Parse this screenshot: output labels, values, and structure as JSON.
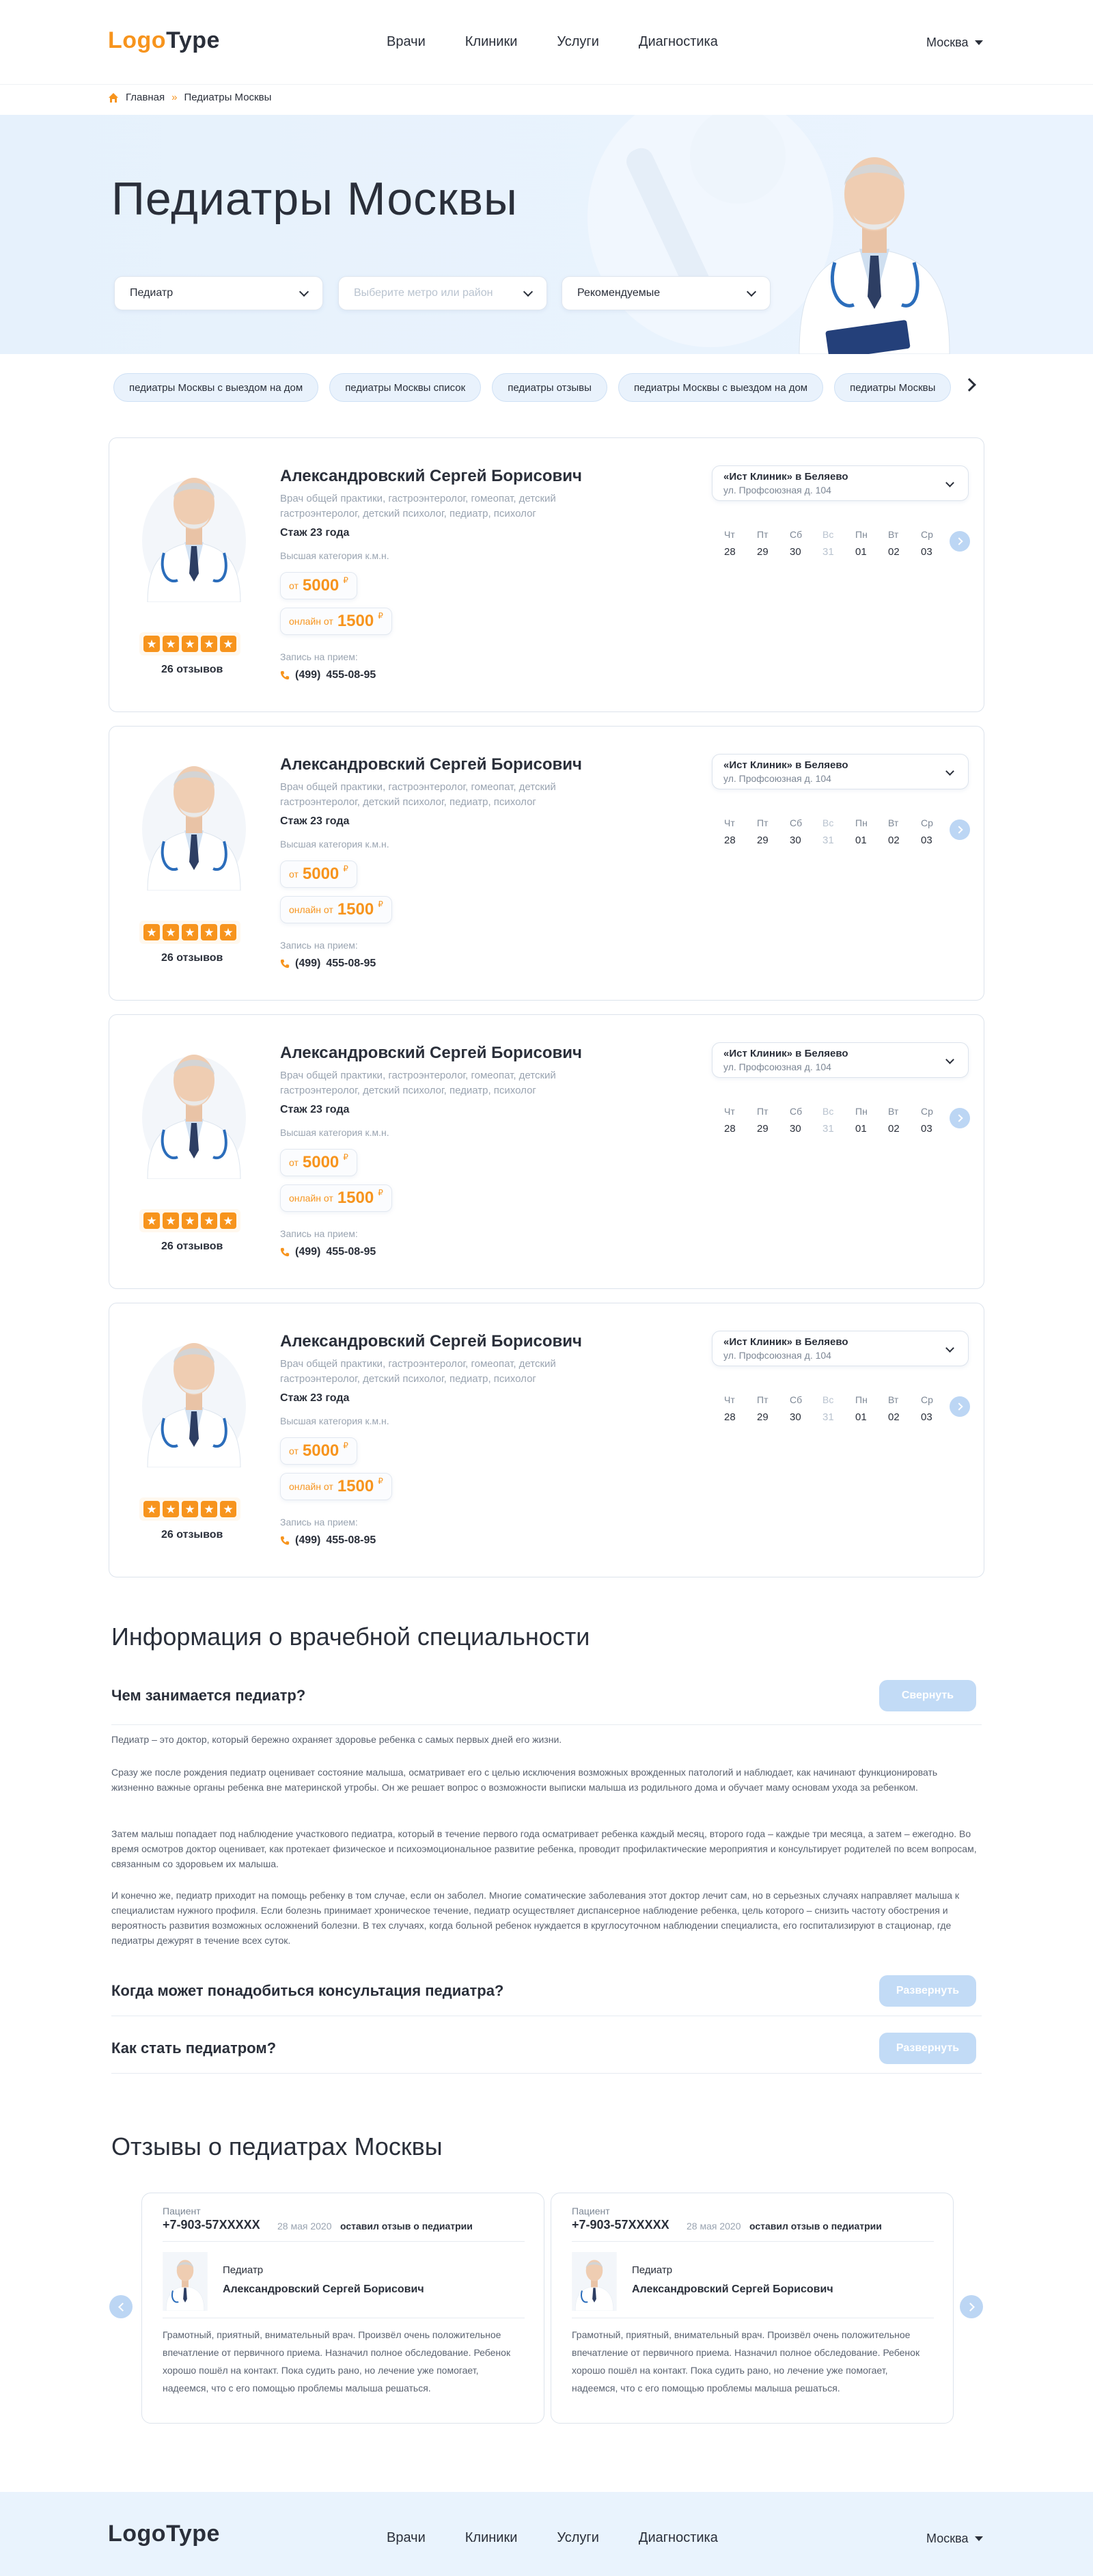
{
  "header": {
    "logo_part1": "Logo",
    "logo_part2": "Type",
    "nav": [
      "Врачи",
      "Клиники",
      "Услуги",
      "Диагностика"
    ],
    "city": "Москва"
  },
  "breadcrumbs": {
    "home": "Главная",
    "separator": "»",
    "current": "Педиатры Москвы"
  },
  "hero": {
    "title": "Педиатры Москвы",
    "filter_specialty": "Педиатр",
    "filter_location_placeholder": "Выберите метро или район",
    "filter_sort": "Рекомендуемые"
  },
  "chips": [
    "педиатры Москвы с выездом на дом",
    "педиатры Москвы список",
    "педиатры отзывы",
    "педиатры Москвы с выездом на дом",
    "педиатры Москвы"
  ],
  "doctors": [
    {
      "name": "Александровский Сергей Борисович",
      "specialties_line1": "Врач общей практики,  гастроэнтеролог,  гомеопат,  детский",
      "specialties_line2": "гастроэнтеролог,  детский психолог,  педиатр,  психолог",
      "experience": "Стаж 23 года",
      "category": "Высшая категория к.м.н.",
      "price_prefix": "от",
      "price": "5000",
      "online_prefix": "онлайн от",
      "online_price": "1500",
      "currency": "₽",
      "appointment_label": "Запись на прием:",
      "phone_code": "(499)",
      "phone_number": "455-08-95",
      "rating_stars": 5,
      "reviews": "26 отзывов",
      "clinic_name": "«Ист Клиник» в Беляево",
      "clinic_address": "ул. Профсоюзная д. 104"
    },
    {
      "name": "Александровский Сергей Борисович",
      "specialties_line1": "Врач общей практики,  гастроэнтеролог,  гомеопат,  детский",
      "specialties_line2": "гастроэнтеролог,  детский психолог,  педиатр,  психолог",
      "experience": "Стаж 23 года",
      "category": "Высшая категория к.м.н.",
      "price_prefix": "от",
      "price": "5000",
      "online_prefix": "онлайн от",
      "online_price": "1500",
      "currency": "₽",
      "appointment_label": "Запись на прием:",
      "phone_code": "(499)",
      "phone_number": "455-08-95",
      "rating_stars": 5,
      "reviews": "26 отзывов",
      "clinic_name": "«Ист Клиник» в Беляево",
      "clinic_address": "ул. Профсоюзная д. 104"
    },
    {
      "name": "Александровский Сергей Борисович",
      "specialties_line1": "Врач общей практики,  гастроэнтеролог,  гомеопат,  детский",
      "specialties_line2": "гастроэнтеролог,  детский психолог,  педиатр,  психолог",
      "experience": "Стаж 23 года",
      "category": "Высшая категория к.м.н.",
      "price_prefix": "от",
      "price": "5000",
      "online_prefix": "онлайн от",
      "online_price": "1500",
      "currency": "₽",
      "appointment_label": "Запись на прием:",
      "phone_code": "(499)",
      "phone_number": "455-08-95",
      "rating_stars": 5,
      "reviews": "26 отзывов",
      "clinic_name": "«Ист Клиник» в Беляево",
      "clinic_address": "ул. Профсоюзная д. 104"
    },
    {
      "name": "Александровский Сергей Борисович",
      "specialties_line1": "Врач общей практики,  гастроэнтеролог,  гомеопат,  детский",
      "specialties_line2": "гастроэнтеролог,  детский психолог,  педиатр,  психолог",
      "experience": "Стаж 23 года",
      "category": "Высшая категория к.м.н.",
      "price_prefix": "от",
      "price": "5000",
      "online_prefix": "онлайн от",
      "online_price": "1500",
      "currency": "₽",
      "appointment_label": "Запись на прием:",
      "phone_code": "(499)",
      "phone_number": "455-08-95",
      "rating_stars": 5,
      "reviews": "26 отзывов",
      "clinic_name": "«Ист Клиник» в Беляево",
      "clinic_address": "ул. Профсоюзная д. 104"
    }
  ],
  "schedule_days": [
    {
      "weekday": "Чт",
      "date": "28",
      "off": false
    },
    {
      "weekday": "Пт",
      "date": "29",
      "off": false
    },
    {
      "weekday": "Сб",
      "date": "30",
      "off": false
    },
    {
      "weekday": "Вс",
      "date": "31",
      "off": true
    },
    {
      "weekday": "Пн",
      "date": "01",
      "off": false
    },
    {
      "weekday": "Вт",
      "date": "02",
      "off": false
    },
    {
      "weekday": "Ср",
      "date": "03",
      "off": false
    }
  ],
  "info": {
    "title": "Информация о врачебной специальности",
    "q1": "Чем занимается педиатр?",
    "q1_button": "Свернуть",
    "paragraphs": [
      "Педиатр – это доктор, который бережно охраняет здоровье ребенка с самых первых дней его жизни.",
      "Сразу же после рождения педиатр оценивает состояние малыша, осматривает его с целью исключения возможных врожденных патологий и наблюдает, как начинают функционировать жизненно важные органы ребенка вне материнской утробы. Он же решает вопрос о возможности выписки малыша из родильного дома и обучает маму основам ухода за ребенком.",
      "Затем малыш попадает под наблюдение участкового педиатра, который в течение первого года осматривает ребенка каждый месяц, второго года – каждые три месяца, а затем – ежегодно. Во время осмотров доктор оценивает, как протекает физическое и психоэмоциональное развитие ребенка, проводит профилактические мероприятия и консультирует родителей по всем вопросам, связанным со здоровьем их малыша.",
      "И конечно же, педиатр приходит на помощь ребенку в том случае, если он заболел. Многие соматические заболевания этот доктор лечит сам, но в серьезных случаях направляет малыша к специалистам нужного профиля. Если болезнь принимает хроническое течение, педиатр осуществляет диспансерное наблюдение ребенка, цель которого – снизить частоту обострения и вероятность развития возможных осложнений болезни. В тех случаях, когда больной ребенок нуждается в круглосуточном наблюдении специалиста, его госпитализируют в стационар, где педиатры дежурят в течение всех суток."
    ],
    "q2": "Когда может понадобиться консультация педиатра?",
    "q2_button": "Развернуть",
    "q3": "Как стать педиатром?",
    "q3_button": "Развернуть"
  },
  "reviews_section": {
    "title": "Отзывы о педиатрах Москвы",
    "items": [
      {
        "label": "Пациент",
        "phone": "+7-903-57XXXXX",
        "date": "28 мая 2020",
        "action": "оставил отзыв о педиатрии",
        "spec": "Педиатр",
        "doctor": "Александровский Сергей Борисович",
        "text": "Грамотный, приятный, внимательный врач. Произвёл очень положительное впечатление от первичного приема. Назначил полное обследование. Ребенок хорошо пошёл на контакт. Пока судить рано, но лечение уже помогает, надеемся, что с его помощью проблемы малыша решаться."
      },
      {
        "label": "Пациент",
        "phone": "+7-903-57XXXXX",
        "date": "28 мая 2020",
        "action": "оставил отзыв о педиатрии",
        "spec": "Педиатр",
        "doctor": "Александровский Сергей Борисович",
        "text": "Грамотный, приятный, внимательный врач. Произвёл очень положительное впечатление от первичного приема. Назначил полное обследование. Ребенок хорошо пошёл на контакт. Пока судить рано, но лечение уже помогает, надеемся, что с его помощью проблемы малыша решаться."
      }
    ]
  },
  "footer": {
    "logo_part1": "Logo",
    "logo_part2": "Type",
    "nav": [
      "Врачи",
      "Клиники",
      "Услуги",
      "Диагностика"
    ],
    "city": "Москва"
  },
  "colors": {
    "accent": "#f7941d",
    "hero_bg": "#e9f3fd",
    "button_blue": "#c2dbf6",
    "text": "#2a2f3a"
  }
}
